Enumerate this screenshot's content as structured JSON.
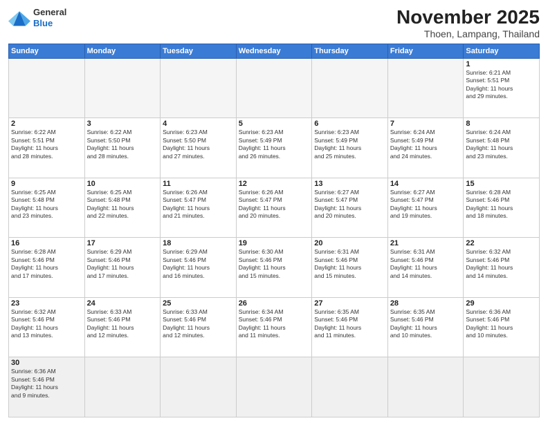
{
  "header": {
    "logo_general": "General",
    "logo_blue": "Blue",
    "month_title": "November 2025",
    "location": "Thoen, Lampang, Thailand"
  },
  "weekdays": [
    "Sunday",
    "Monday",
    "Tuesday",
    "Wednesday",
    "Thursday",
    "Friday",
    "Saturday"
  ],
  "weeks": [
    [
      {
        "day": "",
        "info": ""
      },
      {
        "day": "",
        "info": ""
      },
      {
        "day": "",
        "info": ""
      },
      {
        "day": "",
        "info": ""
      },
      {
        "day": "",
        "info": ""
      },
      {
        "day": "",
        "info": ""
      },
      {
        "day": "1",
        "info": "Sunrise: 6:21 AM\nSunset: 5:51 PM\nDaylight: 11 hours\nand 29 minutes."
      }
    ],
    [
      {
        "day": "2",
        "info": "Sunrise: 6:22 AM\nSunset: 5:51 PM\nDaylight: 11 hours\nand 28 minutes."
      },
      {
        "day": "3",
        "info": "Sunrise: 6:22 AM\nSunset: 5:50 PM\nDaylight: 11 hours\nand 28 minutes."
      },
      {
        "day": "4",
        "info": "Sunrise: 6:23 AM\nSunset: 5:50 PM\nDaylight: 11 hours\nand 27 minutes."
      },
      {
        "day": "5",
        "info": "Sunrise: 6:23 AM\nSunset: 5:49 PM\nDaylight: 11 hours\nand 26 minutes."
      },
      {
        "day": "6",
        "info": "Sunrise: 6:23 AM\nSunset: 5:49 PM\nDaylight: 11 hours\nand 25 minutes."
      },
      {
        "day": "7",
        "info": "Sunrise: 6:24 AM\nSunset: 5:49 PM\nDaylight: 11 hours\nand 24 minutes."
      },
      {
        "day": "8",
        "info": "Sunrise: 6:24 AM\nSunset: 5:48 PM\nDaylight: 11 hours\nand 23 minutes."
      }
    ],
    [
      {
        "day": "9",
        "info": "Sunrise: 6:25 AM\nSunset: 5:48 PM\nDaylight: 11 hours\nand 23 minutes."
      },
      {
        "day": "10",
        "info": "Sunrise: 6:25 AM\nSunset: 5:48 PM\nDaylight: 11 hours\nand 22 minutes."
      },
      {
        "day": "11",
        "info": "Sunrise: 6:26 AM\nSunset: 5:47 PM\nDaylight: 11 hours\nand 21 minutes."
      },
      {
        "day": "12",
        "info": "Sunrise: 6:26 AM\nSunset: 5:47 PM\nDaylight: 11 hours\nand 20 minutes."
      },
      {
        "day": "13",
        "info": "Sunrise: 6:27 AM\nSunset: 5:47 PM\nDaylight: 11 hours\nand 20 minutes."
      },
      {
        "day": "14",
        "info": "Sunrise: 6:27 AM\nSunset: 5:47 PM\nDaylight: 11 hours\nand 19 minutes."
      },
      {
        "day": "15",
        "info": "Sunrise: 6:28 AM\nSunset: 5:46 PM\nDaylight: 11 hours\nand 18 minutes."
      }
    ],
    [
      {
        "day": "16",
        "info": "Sunrise: 6:28 AM\nSunset: 5:46 PM\nDaylight: 11 hours\nand 17 minutes."
      },
      {
        "day": "17",
        "info": "Sunrise: 6:29 AM\nSunset: 5:46 PM\nDaylight: 11 hours\nand 17 minutes."
      },
      {
        "day": "18",
        "info": "Sunrise: 6:29 AM\nSunset: 5:46 PM\nDaylight: 11 hours\nand 16 minutes."
      },
      {
        "day": "19",
        "info": "Sunrise: 6:30 AM\nSunset: 5:46 PM\nDaylight: 11 hours\nand 15 minutes."
      },
      {
        "day": "20",
        "info": "Sunrise: 6:31 AM\nSunset: 5:46 PM\nDaylight: 11 hours\nand 15 minutes."
      },
      {
        "day": "21",
        "info": "Sunrise: 6:31 AM\nSunset: 5:46 PM\nDaylight: 11 hours\nand 14 minutes."
      },
      {
        "day": "22",
        "info": "Sunrise: 6:32 AM\nSunset: 5:46 PM\nDaylight: 11 hours\nand 14 minutes."
      }
    ],
    [
      {
        "day": "23",
        "info": "Sunrise: 6:32 AM\nSunset: 5:46 PM\nDaylight: 11 hours\nand 13 minutes."
      },
      {
        "day": "24",
        "info": "Sunrise: 6:33 AM\nSunset: 5:46 PM\nDaylight: 11 hours\nand 12 minutes."
      },
      {
        "day": "25",
        "info": "Sunrise: 6:33 AM\nSunset: 5:46 PM\nDaylight: 11 hours\nand 12 minutes."
      },
      {
        "day": "26",
        "info": "Sunrise: 6:34 AM\nSunset: 5:46 PM\nDaylight: 11 hours\nand 11 minutes."
      },
      {
        "day": "27",
        "info": "Sunrise: 6:35 AM\nSunset: 5:46 PM\nDaylight: 11 hours\nand 11 minutes."
      },
      {
        "day": "28",
        "info": "Sunrise: 6:35 AM\nSunset: 5:46 PM\nDaylight: 11 hours\nand 10 minutes."
      },
      {
        "day": "29",
        "info": "Sunrise: 6:36 AM\nSunset: 5:46 PM\nDaylight: 11 hours\nand 10 minutes."
      }
    ],
    [
      {
        "day": "30",
        "info": "Sunrise: 6:36 AM\nSunset: 5:46 PM\nDaylight: 11 hours\nand 9 minutes."
      },
      {
        "day": "",
        "info": ""
      },
      {
        "day": "",
        "info": ""
      },
      {
        "day": "",
        "info": ""
      },
      {
        "day": "",
        "info": ""
      },
      {
        "day": "",
        "info": ""
      },
      {
        "day": "",
        "info": ""
      }
    ]
  ]
}
